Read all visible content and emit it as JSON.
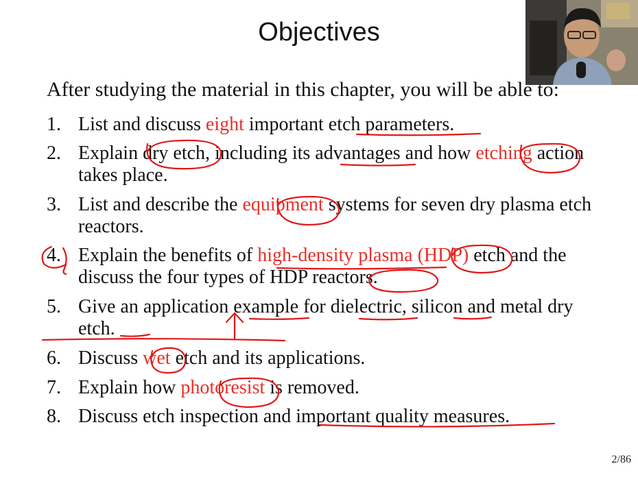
{
  "slide": {
    "title": "Objectives",
    "intro": "After studying the material in this chapter, you will be able to:",
    "page": "2/86",
    "items": [
      {
        "num": "1.",
        "parts": [
          {
            "t": "List and discuss "
          },
          {
            "t": "eight",
            "red": true
          },
          {
            "t": " important etch parameters."
          }
        ]
      },
      {
        "num": "2.",
        "parts": [
          {
            "t": "Explain dry etch, including its advantages and how "
          },
          {
            "t": "etching",
            "red": true
          },
          {
            "t": " action takes place."
          }
        ]
      },
      {
        "num": "3.",
        "parts": [
          {
            "t": "List and describe the "
          },
          {
            "t": "equipment",
            "red": true
          },
          {
            "t": " systems for seven dry plasma etch reactors."
          }
        ]
      },
      {
        "num": "4.",
        "parts": [
          {
            "t": "Explain the benefits of "
          },
          {
            "t": "high-density plasma (HDP)",
            "red": true
          },
          {
            "t": " etch and the discuss the four types of HDP reactors."
          }
        ]
      },
      {
        "num": "5.",
        "parts": [
          {
            "t": "Give an application example for dielectric, silicon and metal dry etch."
          }
        ]
      },
      {
        "num": "6.",
        "parts": [
          {
            "t": "Discuss "
          },
          {
            "t": "wet",
            "red": true
          },
          {
            "t": " etch and its applications."
          }
        ]
      },
      {
        "num": "7.",
        "parts": [
          {
            "t": "Explain how "
          },
          {
            "t": "photoresist",
            "red": true
          },
          {
            "t": " is removed."
          }
        ]
      },
      {
        "num": "8.",
        "parts": [
          {
            "t": "Discuss etch inspection and important quality measures."
          }
        ]
      }
    ]
  },
  "colors": {
    "accent": "#e8302a",
    "text": "#111111",
    "ink": "#e01818"
  },
  "webcam": {
    "icon": "presenter-video-icon"
  }
}
